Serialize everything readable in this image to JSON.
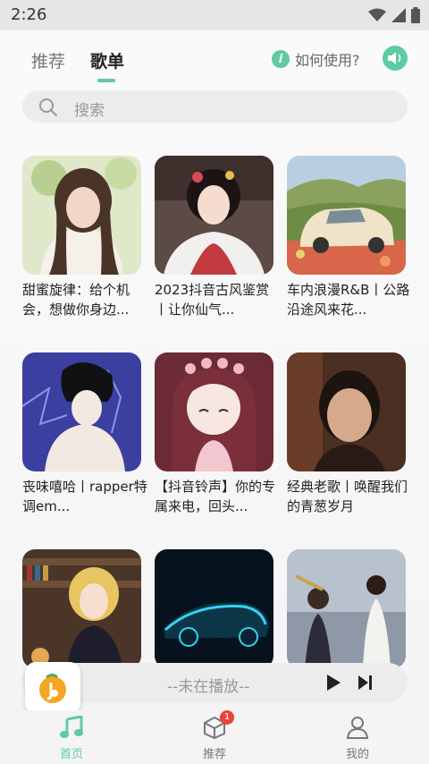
{
  "status_bar": {
    "time": "2:26"
  },
  "header": {
    "tabs": [
      {
        "label": "推荐",
        "active": false
      },
      {
        "label": "歌单",
        "active": true
      }
    ],
    "help_label": "如何使用?",
    "help_icon": "info-icon",
    "sound_icon": "speaker-icon"
  },
  "search": {
    "placeholder": "搜索"
  },
  "playlists": [
    {
      "title": "甜蜜旋律：给个机会，想做你身边..."
    },
    {
      "title": "2023抖音古风鉴赏丨让你仙气..."
    },
    {
      "title": "车内浪漫R&B丨公路沿途风来花..."
    },
    {
      "title": "丧味嘻哈丨rapper特调em..."
    },
    {
      "title": "【抖音铃声】你的专属来电，回头..."
    },
    {
      "title": "经典老歌丨唤醒我们的青葱岁月"
    },
    {
      "title": ""
    },
    {
      "title": ""
    },
    {
      "title": ""
    }
  ],
  "player": {
    "status": "--未在播放--"
  },
  "bottom_nav": {
    "items": [
      {
        "label": "首页",
        "icon": "music-note-icon",
        "active": true
      },
      {
        "label": "推荐",
        "icon": "cube-icon",
        "active": false,
        "badge": "1"
      },
      {
        "label": "我的",
        "icon": "user-icon",
        "active": false
      }
    ]
  },
  "colors": {
    "accent": "#5ecba1",
    "badge": "#e8453c"
  }
}
